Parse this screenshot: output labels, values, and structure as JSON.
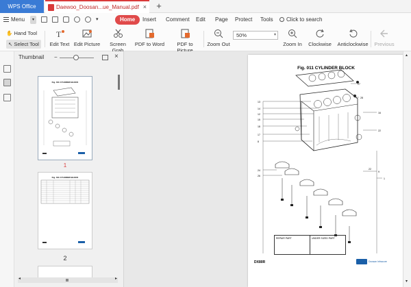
{
  "titlebar": {
    "app_tab": "WPS Office",
    "doc_tab": "Daewoo_Doosan...ue_Manual.pdf",
    "new_tab": "+"
  },
  "menu": {
    "menu_label": "Menu",
    "items": [
      "Home",
      "Insert",
      "Comment",
      "Edit",
      "Page",
      "Protect",
      "Tools"
    ],
    "search": "Click to search"
  },
  "ribbon": {
    "hand_tool": "Hand Tool",
    "select_tool": "Select Tool",
    "edit_text": "Edit Text",
    "edit_picture": "Edit Picture",
    "screen_grab": "Screen Grab",
    "pdf_to_word": "PDF to Word",
    "pdf_to_picture": "PDF to Picture",
    "zoom_out": "Zoom Out",
    "zoom_value": "50%",
    "zoom_in": "Zoom In",
    "clockwise": "Clockwise",
    "anticlockwise": "Anticlockwise",
    "previous": "Previous"
  },
  "thumbnail": {
    "title": "Thumbnail",
    "pages": [
      "1",
      "2"
    ],
    "page1_title": "Fig. 011 CYLINDER BLOCK",
    "page2_title": "Fig. 011 CYLINDER BLOCK"
  },
  "document": {
    "figure_title": "Fig. 011 CYLINDER BLOCK",
    "model": "DX80R",
    "brand": "Doosan Infracore",
    "legend_left": "REPAIR PART",
    "legend_right": "UNDER SIZED PART"
  },
  "colors": {
    "accent_red": "#e04a4a",
    "app_blue": "#3a7bd5",
    "brand_blue": "#1a5fa8"
  }
}
